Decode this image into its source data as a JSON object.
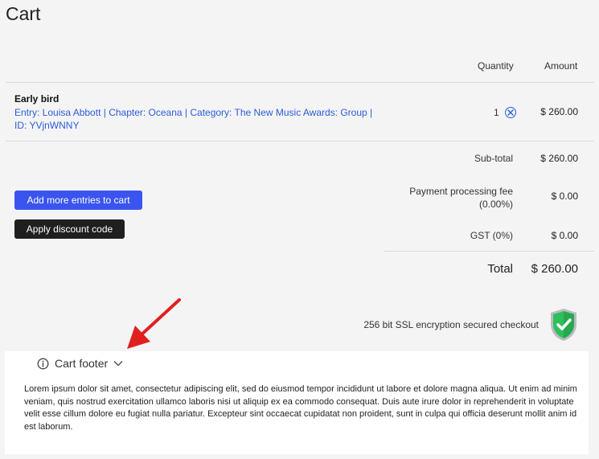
{
  "page": {
    "title": "Cart"
  },
  "table": {
    "headers": {
      "quantity": "Quantity",
      "amount": "Amount"
    },
    "items": [
      {
        "name": "Early bird",
        "description": "Entry: Louisa Abbott | Chapter: Oceana | Category: The New Music Awards: Group | ID: YVjnWNNY",
        "quantity": "1",
        "amount": "$ 260.00"
      }
    ]
  },
  "summary": {
    "subtotal_label": "Sub-total",
    "subtotal_value": "$ 260.00",
    "fee_label_line1": "Payment processing fee",
    "fee_label_line2": "(0.00%)",
    "fee_value": "$ 0.00",
    "gst_label": "GST (0%)",
    "gst_value": "$ 0.00",
    "total_label": "Total",
    "total_value": "$ 260.00"
  },
  "actions": {
    "add_more_label": "Add more entries to cart",
    "apply_discount_label": "Apply discount code"
  },
  "security": {
    "text": "256 bit SSL encryption secured checkout"
  },
  "footer": {
    "title": "Cart footer",
    "body": "Lorem ipsum dolor sit amet, consectetur adipiscing elit, sed do eiusmod tempor incididunt ut labore et dolore magna aliqua. Ut enim ad minim veniam, quis nostrud exercitation ullamco laboris nisi ut aliquip ex ea commodo consequat. Duis aute irure dolor in reprehenderit in voluptate velit esse cillum dolore eu fugiat nulla pariatur. Excepteur sint occaecat cupidatat non proident, sunt in culpa qui officia deserunt mollit anim id est laborum."
  },
  "icons": {
    "remove": "remove-circle-x-icon",
    "shield": "shield-check-icon",
    "info": "info-icon",
    "chevron": "chevron-down-icon",
    "annotation": "red-arrow-annotation"
  },
  "colors": {
    "accent_blue": "#3a55ef",
    "link_blue": "#2b5cd9",
    "dark_button": "#1f1f1f",
    "shield_green": "#2fbf5a",
    "annotation_red": "#e02020"
  }
}
